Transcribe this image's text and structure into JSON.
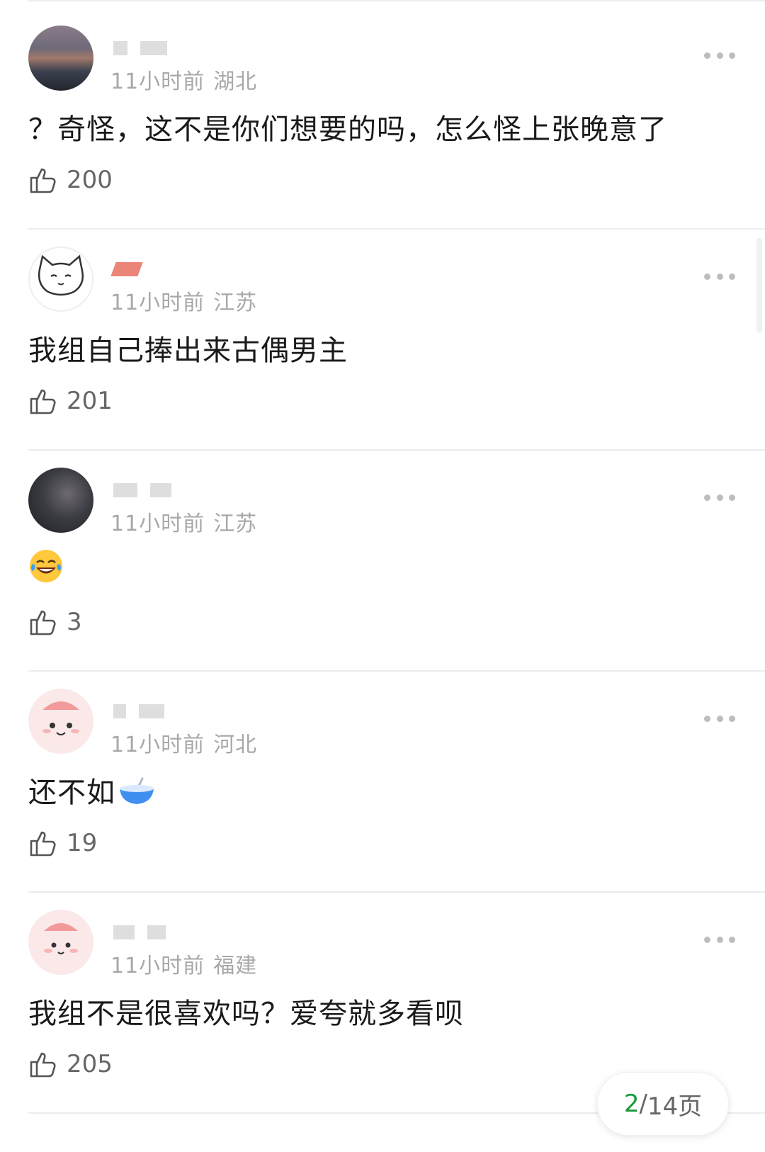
{
  "comments": [
    {
      "time": "11小时前",
      "location": "湖北",
      "text": "？奇怪，这不是你们想要的吗，怎么怪上张晚意了",
      "likes": "200"
    },
    {
      "time": "11小时前",
      "location": "江苏",
      "text": "我组自己捧出来古偶男主",
      "likes": "201"
    },
    {
      "time": "11小时前",
      "location": "江苏",
      "text": "",
      "emoji": "laughing-crying-emoji",
      "likes": "3"
    },
    {
      "time": "11小时前",
      "location": "河北",
      "text": "还不如",
      "emoji": "bowl-emoji",
      "likes": "19"
    },
    {
      "time": "11小时前",
      "location": "福建",
      "text": "我组不是很喜欢吗？爱夸就多看呗",
      "likes": "205"
    }
  ],
  "pagination": {
    "current": "2",
    "separator": "/",
    "total_label": "14页"
  },
  "colors": {
    "accent_green": "#1a9a3c",
    "meta_gray": "#a8a8a8",
    "text": "#1a1a1a"
  }
}
